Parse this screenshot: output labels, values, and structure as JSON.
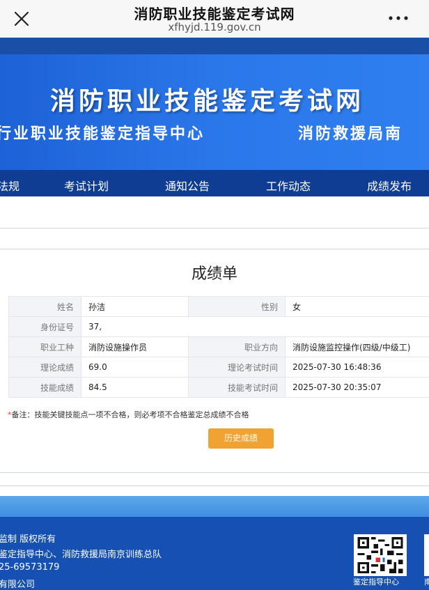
{
  "browser": {
    "title": "消防职业技能鉴定考试网",
    "url": "xfhyjd.119.gov.cn"
  },
  "banner": {
    "title": "消防职业技能鉴定考试网",
    "subtitle_left": "行业职业技能鉴定指导中心",
    "subtitle_right": "消防救援局南"
  },
  "nav": {
    "items": [
      "法规",
      "考试计划",
      "通知公告",
      "工作动态",
      "成绩发布"
    ]
  },
  "scorecard": {
    "title": "成绩单",
    "fields": {
      "name_label": "姓名",
      "name_value": "孙洁",
      "gender_label": "性别",
      "gender_value": "女",
      "id_label": "身份证号",
      "id_value": "37,",
      "occupation_label": "职业工种",
      "occupation_value": "消防设施操作员",
      "direction_label": "职业方向",
      "direction_value": "消防设施监控操作(四级/中级工)",
      "theory_score_label": "理论成绩",
      "theory_score_value": "69.0",
      "theory_time_label": "理论考试时间",
      "theory_time_value": "2025-07-30 16:48:36",
      "skill_score_label": "技能成绩",
      "skill_score_value": "84.5",
      "skill_time_label": "技能考试时间",
      "skill_time_value": "2025-07-30 20:35:07"
    },
    "note_star": "*",
    "note_text": "备注：技能关键技能点一项不合格，则必考项不合格鉴定总成绩不合格",
    "history_button": "历史成绩"
  },
  "footer": {
    "lines": [
      "监制 版权所有",
      "鉴定指导中心、消防救援局南京训练总队",
      "25-69573179",
      "有限公司"
    ],
    "qr_caption_1": "鉴定指导中心",
    "qr_caption_2": "南"
  },
  "colors": {
    "nav_bg": "#0f3d93",
    "banner_bg": "#2a77ea",
    "button_orange": "#f0a232",
    "link_blue": "#2a87d4"
  }
}
